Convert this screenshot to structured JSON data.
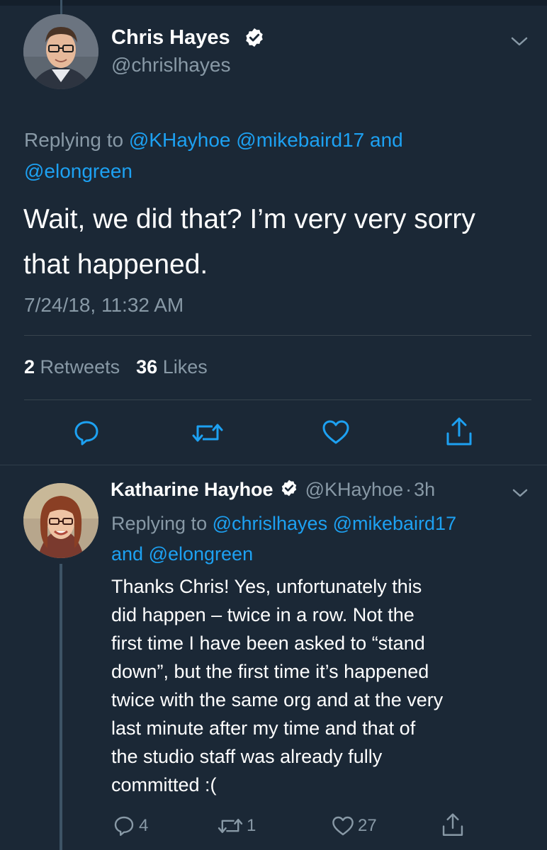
{
  "main_tweet": {
    "author_name": "Chris Hayes",
    "author_handle": "@chrislhayes",
    "replying_prefix": "Replying to",
    "reply_mention_1": "@KHayhoe",
    "reply_mention_2": "@mikebaird17",
    "reply_and": "and",
    "reply_mention_3": "@elongreen",
    "text_line_1": "Wait, we did that? I’m very very sorry",
    "text_line_2": "that happened.",
    "timestamp": "7/24/18, 11:32 AM",
    "retweets_count": "2",
    "retweets_label": "Retweets",
    "likes_count": "36",
    "likes_label": "Likes"
  },
  "reply_tweet": {
    "author_name": "Katharine Hayhoe",
    "author_handle": "@KHayhoe",
    "separator": "·",
    "time_ago": "3h",
    "replying_prefix": "Replying to",
    "reply_mention_1": "@chrislhayes",
    "reply_mention_2": "@mikebaird17",
    "reply_and": "and",
    "reply_mention_3": "@elongreen",
    "text_lines": [
      "Thanks Chris! Yes, unfortunately this",
      "did happen – twice in a row. Not the",
      "first time I have been asked to “stand",
      "down”, but the first time it’s happened",
      "twice with the same org and at the very",
      "last minute after my time and that of",
      "the studio staff was already fully",
      "committed :("
    ],
    "reply_count": "4",
    "retweet_count": "1",
    "like_count": "27"
  },
  "icons": {
    "reply": "reply-icon",
    "retweet": "retweet-icon",
    "like": "heart-icon",
    "share": "share-icon",
    "more": "chevron-down-icon",
    "verified": "verified-badge-icon"
  },
  "colors": {
    "background": "#1b2836",
    "link": "#1da1f2",
    "muted": "#8899a6",
    "divider": "#38444d"
  }
}
